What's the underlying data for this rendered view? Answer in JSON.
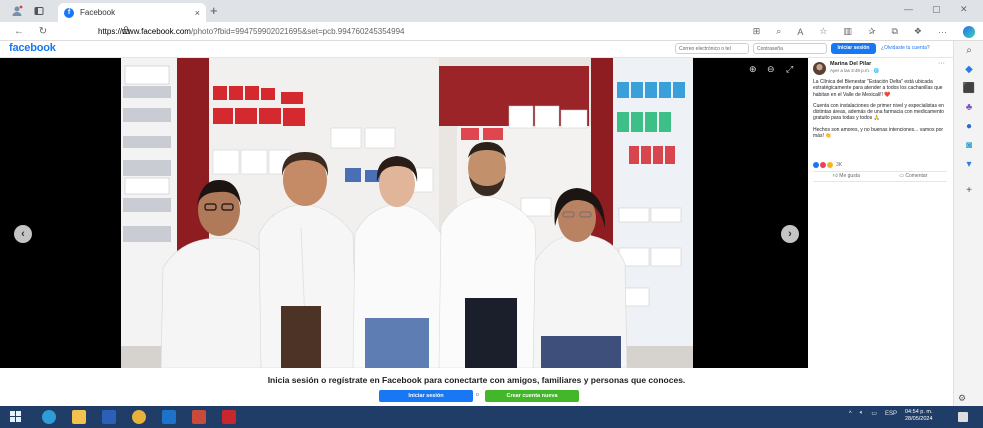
{
  "browser": {
    "tab_title": "Facebook",
    "tab_close": "×",
    "new_tab": "+",
    "url_host": "https://www.facebook.com",
    "url_path": "/photo?fbid=994759902021695&set=pcb.994760245354994",
    "window_minimize": "—",
    "window_restore": "▢",
    "window_close": "✕"
  },
  "facebook_header": {
    "logo": "facebook",
    "email_placeholder": "Correo electrónico o tel",
    "password_placeholder": "Contraseña",
    "login_button": "Iniciar sesión",
    "forgot_link": "¿Olvidaste tu cuenta?"
  },
  "post": {
    "author": "Marina Del Pilar",
    "date": "Ayer a las 3:49 p.m. · 🌐",
    "more": "···",
    "paragraphs": [
      "La Clínica del Bienestar \"Estación Delta\" está ubicada estratégicamente para atender a todos los cachanillas que habitan en el Valle de Mexicali!! ❤️",
      "Cuenta con instalaciones de primer nivel y especialistas en distintas áreas, además de una farmacia con medicamento gratuito para todas y todos 🙏",
      "Hechos son amores, y no buenas intenciones... vamos por más! 👏"
    ],
    "reaction_count": "3K",
    "like_label": "Me gusta",
    "comment_label": "Comentar"
  },
  "prompt": {
    "message": "Inicia sesión o regístrate en Facebook para conectarte con amigos, familiares y personas que conoces.",
    "login_button": "Iniciar sesión",
    "or": "o",
    "create_button": "Crear cuenta nueva"
  },
  "taskbar": {
    "language": "ESP",
    "time": "04:54 p. m.",
    "date": "28/05/2024"
  },
  "colors": {
    "facebook_blue": "#1877f2",
    "create_green": "#42b72a",
    "taskbar": "#1f3d66"
  }
}
